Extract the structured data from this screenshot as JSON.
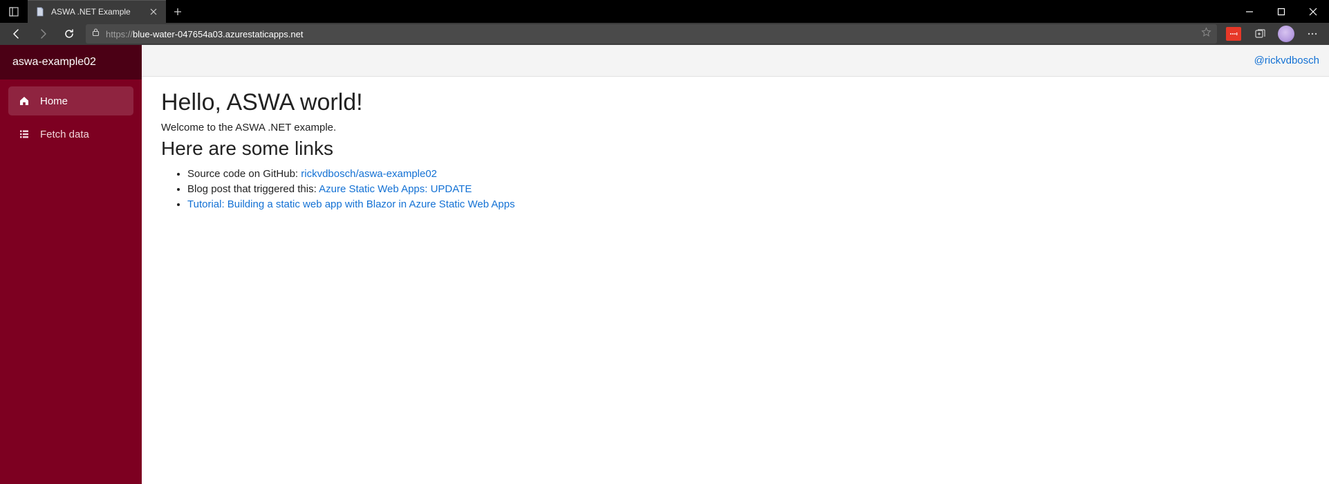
{
  "browser": {
    "tab_title": "ASWA .NET Example",
    "url_protocol": "https://",
    "url_host": "blue-water-047654a03.azurestaticapps.net"
  },
  "sidebar": {
    "title": "aswa-example02",
    "items": [
      {
        "label": "Home"
      },
      {
        "label": "Fetch data"
      }
    ]
  },
  "header": {
    "about_link": "@rickvdbosch"
  },
  "content": {
    "h1": "Hello, ASWA world!",
    "welcome": "Welcome to the ASWA .NET example.",
    "h2": "Here are some links",
    "links": [
      {
        "prefix": "Source code on GitHub: ",
        "link": "rickvdbosch/aswa-example02"
      },
      {
        "prefix": "Blog post that triggered this: ",
        "link": "Azure Static Web Apps: UPDATE"
      },
      {
        "prefix": "",
        "link": "Tutorial: Building a static web app with Blazor in Azure Static Web Apps"
      }
    ]
  }
}
